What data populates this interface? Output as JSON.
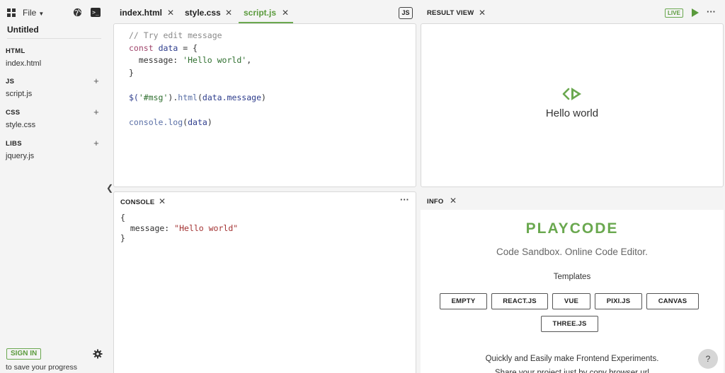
{
  "sidebar": {
    "file_menu": "File",
    "project_title": "Untitled",
    "sections": [
      {
        "head": "HTML",
        "file": "index.html"
      },
      {
        "head": "JS",
        "file": "script.js"
      },
      {
        "head": "CSS",
        "file": "style.css"
      },
      {
        "head": "LIBS",
        "file": "jquery.js"
      }
    ],
    "signin_label": "SIGN IN",
    "save_progress": "to save your progress"
  },
  "tabs": [
    {
      "label": "index.html",
      "active": false
    },
    {
      "label": "style.css",
      "active": false
    },
    {
      "label": "script.js",
      "active": true
    }
  ],
  "editor": {
    "lang_badge": "JS",
    "line1": "// Try edit message",
    "line2_kw": "const",
    "line2_var": "data",
    "line2_rest": " = {",
    "line3_key": "  message: ",
    "line3_str": "'Hello world'",
    "line3_end": ",",
    "line4": "}",
    "line6_a": "$(",
    "line6_str": "'#msg'",
    "line6_b": ").",
    "line6_fn": "html",
    "line6_c": "(",
    "line6_arg": "data.message",
    "line6_d": ")",
    "line8_fn": "console.log",
    "line8_a": "(",
    "line8_arg": "data",
    "line8_b": ")"
  },
  "result": {
    "title": "RESULT VIEW",
    "live_badge": "LIVE",
    "output": "Hello world"
  },
  "console": {
    "title": "CONSOLE",
    "open": "{",
    "key": "  message: ",
    "value": "\"Hello world\"",
    "close": "}"
  },
  "info": {
    "title": "INFO",
    "brand": "PLAYCODE",
    "tagline": "Code Sandbox. Online Code Editor.",
    "templates_head": "Templates",
    "templates": [
      "EMPTY",
      "REACT.JS",
      "VUE",
      "PIXI.JS",
      "CANVAS",
      "THREE.JS"
    ],
    "foot1": "Quickly and Easily make Frontend Experiments.",
    "foot2": "Share your project just by copy browser url"
  },
  "help_label": "?",
  "colors": {
    "accent": "#6aa84f",
    "background": "#f4f4f4",
    "panel": "#ffffff"
  }
}
